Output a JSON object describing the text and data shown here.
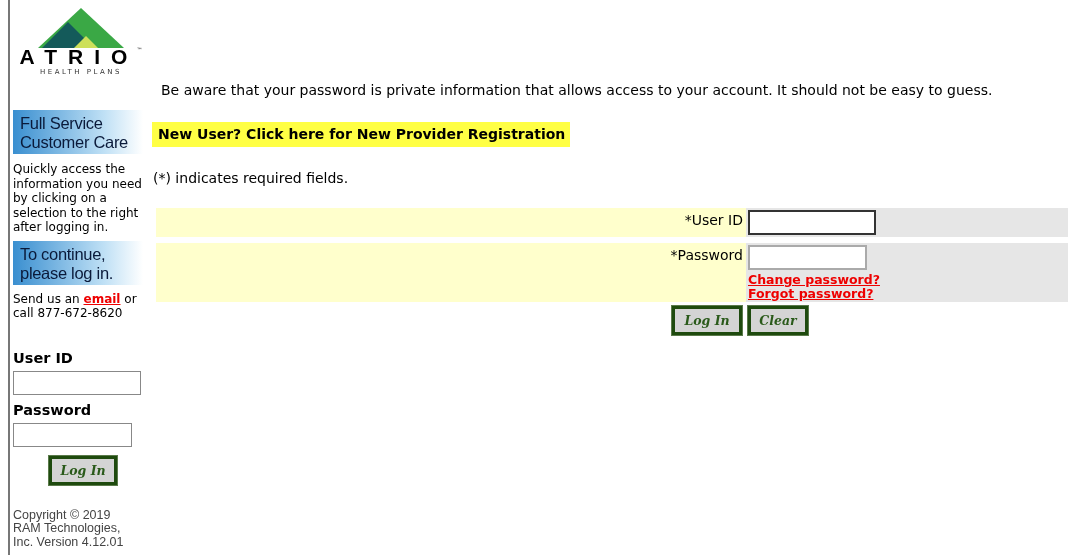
{
  "logo": {
    "name": "ATRIO",
    "trademark": "™",
    "tagline": "HEALTH PLANS"
  },
  "sidebar": {
    "banner_1": "Full Service Customer Care",
    "intro": "Quickly access the information you need by clicking on a selection to the right after logging in.",
    "banner_2": "To continue, please log in.",
    "contact_before": "Send us an",
    "contact_link": "email",
    "contact_after": "or call 877-672-8620",
    "login": {
      "user_label": "User ID",
      "password_label": "Password",
      "button": "Log In"
    },
    "copyright": "Copyright © 2019 RAM Technologies, Inc. Version 4.12.01"
  },
  "main": {
    "notice": "Be aware that your password is private information that allows access to your account. It should not be easy to guess.",
    "registration_link": "New User? Click here for New Provider Registration",
    "required_note": "(*) indicates required fields.",
    "form": {
      "user_label": "*User ID",
      "password_label": "*Password",
      "links": [
        "Change password?",
        "Forgot password?"
      ],
      "buttons": [
        "Log In",
        "Clear"
      ]
    }
  }
}
